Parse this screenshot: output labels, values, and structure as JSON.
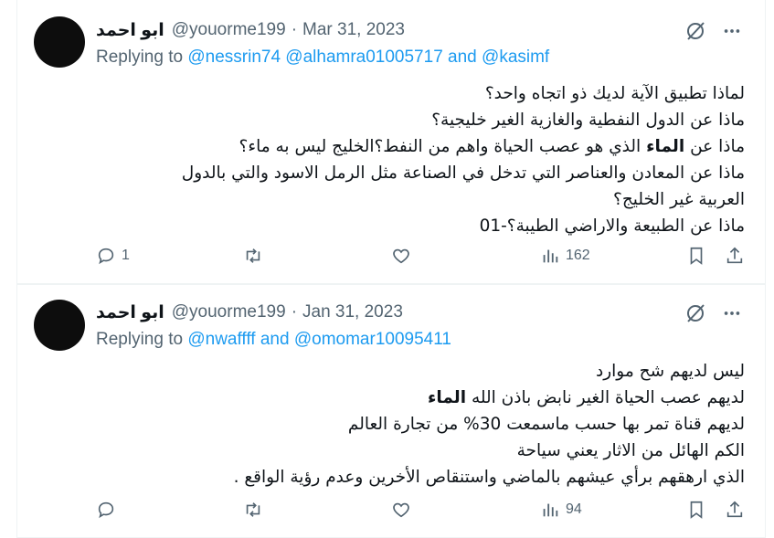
{
  "tweets": [
    {
      "name": "ابو احمد",
      "handle": "@youorme199",
      "separator": "·",
      "date": "Mar 31, 2023",
      "replying_prefix": "Replying to",
      "mentions": [
        "@nessrin74",
        "@alhamra01005717"
      ],
      "and_word": "and",
      "last_mention": "@kasimf",
      "lines": [
        "لماذا تطبيق الآية لديك ذو اتجاه واحد؟",
        "ماذا عن الدول النفطية والغازية الغير خليجية؟",
        "ماذا عن",
        "الماء",
        "الذي هو عصب الحياة واهم من النفط؟الخليج ليس به ماء؟",
        "ماذا عن المعادن والعناصر التي تدخل في الصناعة مثل الرمل الاسود والتي بالدول",
        "العربية غير الخليج؟",
        "ماذا عن الطبيعة والاراضي الطيبة؟-01"
      ],
      "reply_count": "1",
      "views": "162"
    },
    {
      "name": "ابو احمد",
      "handle": "@youorme199",
      "separator": "·",
      "date": "Jan 31, 2023",
      "replying_prefix": "Replying to",
      "mentions": [
        "@nwaffff"
      ],
      "and_word": "and",
      "last_mention": "@omomar10095411",
      "lines": [
        "ليس لديهم شح موارد",
        "لديهم عصب الحياة الغير نابض باذن الله",
        "الماء",
        "لديهم قناة تمر بها حسب ماسمعت 30% من تجارة العالم",
        "الكم الهائل من الاثار يعني سياحة",
        "الذي ارهقهم برأي عيشهم بالماضي واستنقاص الأخرين وعدم رؤية الواقع ."
      ],
      "reply_count": "",
      "views": "94"
    }
  ],
  "icons": {
    "grok": "grok-icon",
    "more": "more-icon",
    "reply": "reply-icon",
    "retweet": "retweet-icon",
    "like": "like-icon",
    "views": "views-icon",
    "bookmark": "bookmark-icon",
    "share": "share-icon"
  },
  "colors": {
    "link": "#1d9bf0",
    "muted": "#536471",
    "text": "#0f1419",
    "border": "#eff3f4"
  }
}
